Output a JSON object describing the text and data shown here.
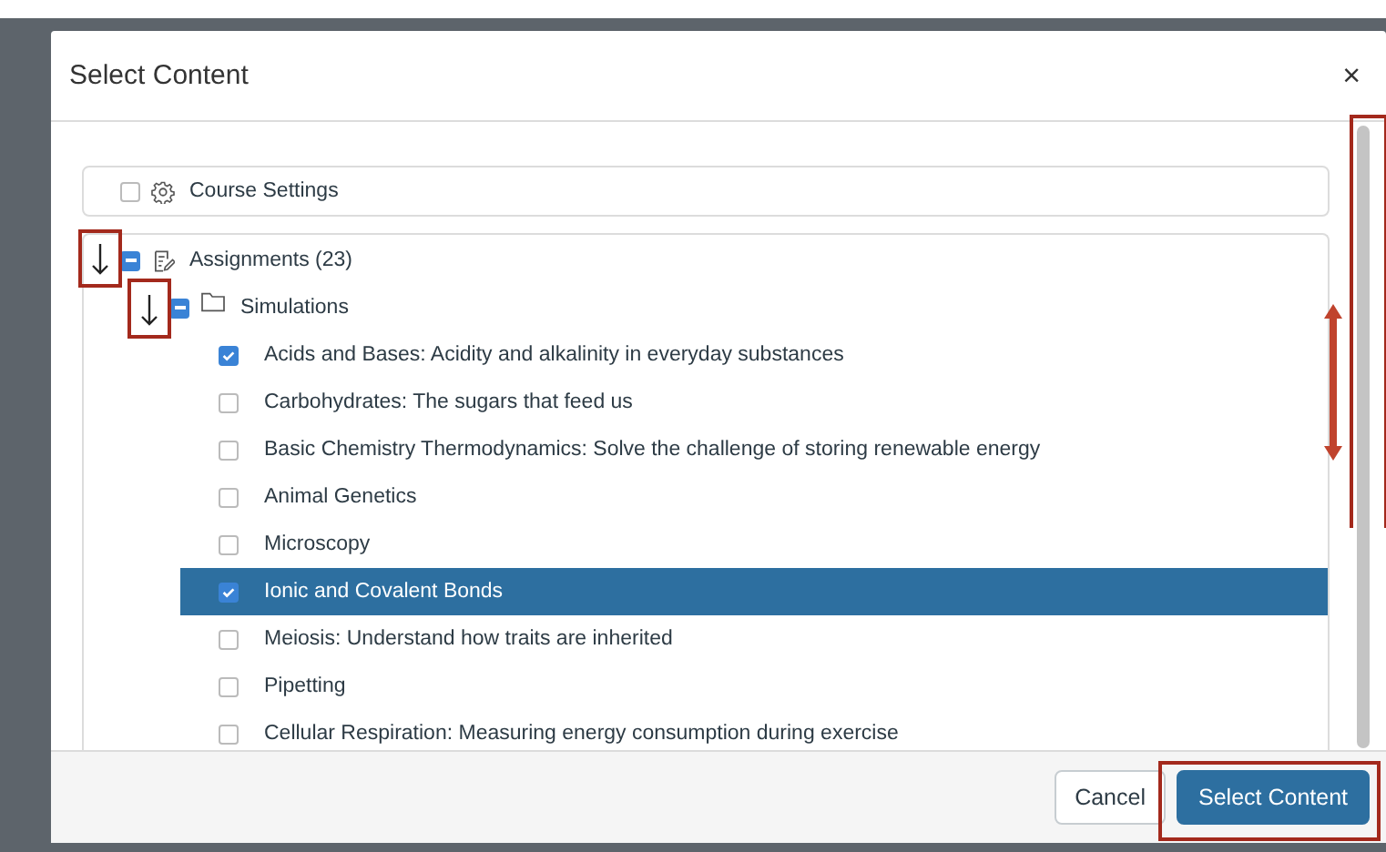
{
  "dialog": {
    "title": "Select Content",
    "close": "×"
  },
  "tree": [
    {
      "label": "Course Settings",
      "checked": false
    },
    {
      "label": "Assignments (23)",
      "indeterminate": true,
      "children": [
        {
          "label": "Simulations",
          "indeterminate": true,
          "children": [
            {
              "label": "Acids and Bases: Acidity and alkalinity in everyday substances",
              "checked": true,
              "selected": false
            },
            {
              "label": "Carbohydrates: The sugars that feed us",
              "checked": false,
              "selected": false
            },
            {
              "label": "Basic Chemistry Thermodynamics: Solve the challenge of storing renewable energy",
              "checked": false,
              "selected": false
            },
            {
              "label": "Animal Genetics",
              "checked": false,
              "selected": false
            },
            {
              "label": "Microscopy",
              "checked": false,
              "selected": false
            },
            {
              "label": "Ionic and Covalent Bonds",
              "checked": true,
              "selected": true
            },
            {
              "label": "Meiosis: Understand how traits are inherited",
              "checked": false,
              "selected": false
            },
            {
              "label": "Pipetting",
              "checked": false,
              "selected": false
            },
            {
              "label": "Cellular Respiration: Measuring energy consumption during exercise",
              "checked": false,
              "selected": false
            }
          ]
        }
      ]
    }
  ],
  "buttons": [
    {
      "label": "Cancel",
      "kind": "secondary"
    },
    {
      "label": "Select Content",
      "kind": "primary"
    }
  ]
}
